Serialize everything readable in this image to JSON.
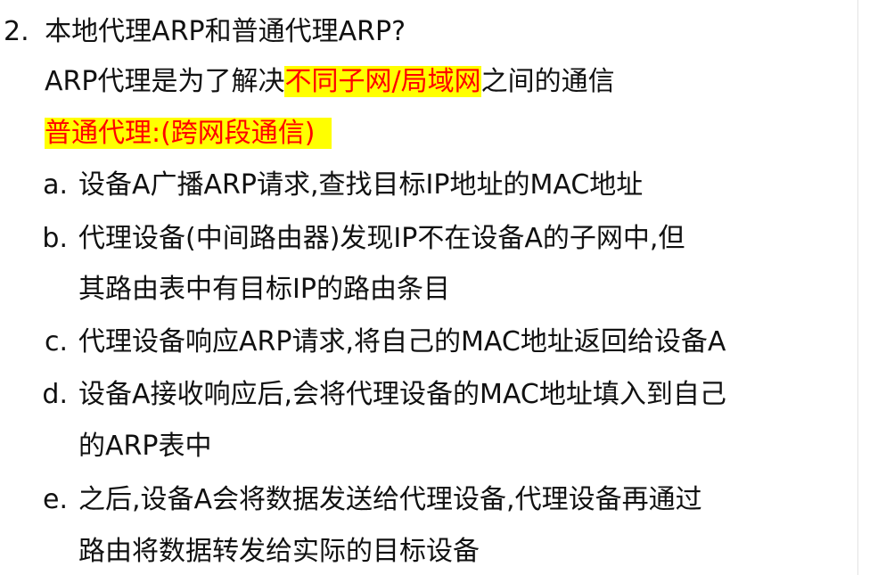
{
  "question": {
    "number": "2.",
    "title": "本地代理ARP和普通代理ARP?"
  },
  "intro": {
    "prefix": "ARP代理是为了解决",
    "highlight": "不同子网/局域网",
    "suffix": "之间的通信"
  },
  "section": {
    "heading": "普通代理:(跨网段通信)"
  },
  "steps": [
    {
      "marker": "a.",
      "lines": [
        "设备A广播ARP请求,查找目标IP地址的MAC地址"
      ]
    },
    {
      "marker": "b.",
      "lines": [
        "代理设备(中间路由器)发现IP不在设备A的子网中,但",
        "其路由表中有目标IP的路由条目"
      ]
    },
    {
      "marker": "c.",
      "lines": [
        "代理设备响应ARP请求,将自己的MAC地址返回给设备A"
      ]
    },
    {
      "marker": "d.",
      "lines": [
        "设备A接收响应后,会将代理设备的MAC地址填入到自己",
        "的ARP表中"
      ]
    },
    {
      "marker": "e.",
      "lines": [
        "之后,设备A会将数据发送给代理设备,代理设备再通过",
        "路由将数据转发给实际的目标设备"
      ]
    }
  ],
  "colors": {
    "highlight_bg": "#ffff00",
    "highlight_text": "#ff0000",
    "body_text": "#111111"
  }
}
